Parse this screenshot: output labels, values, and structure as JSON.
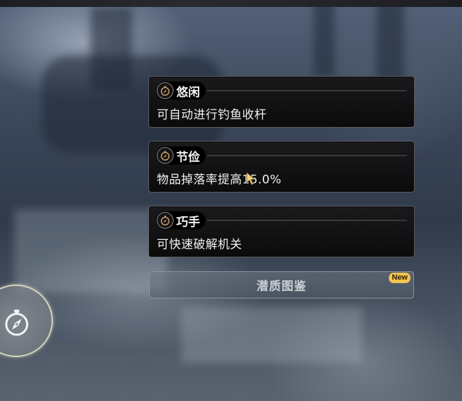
{
  "cards": [
    {
      "title": "悠闲",
      "desc": "可自动进行钓鱼收杆",
      "icon": "compass-icon"
    },
    {
      "title": "节俭",
      "desc": "物品掉落率提高15.0%",
      "icon": "compass-icon"
    },
    {
      "title": "巧手",
      "desc": "可快速破解机关",
      "icon": "compass-icon"
    }
  ],
  "codex_button": {
    "label": "潜质图鉴",
    "badge": "New"
  },
  "colors": {
    "badge": "#f5c451",
    "card_bg": "#0b0b0c",
    "text": "#f0f0f0"
  }
}
